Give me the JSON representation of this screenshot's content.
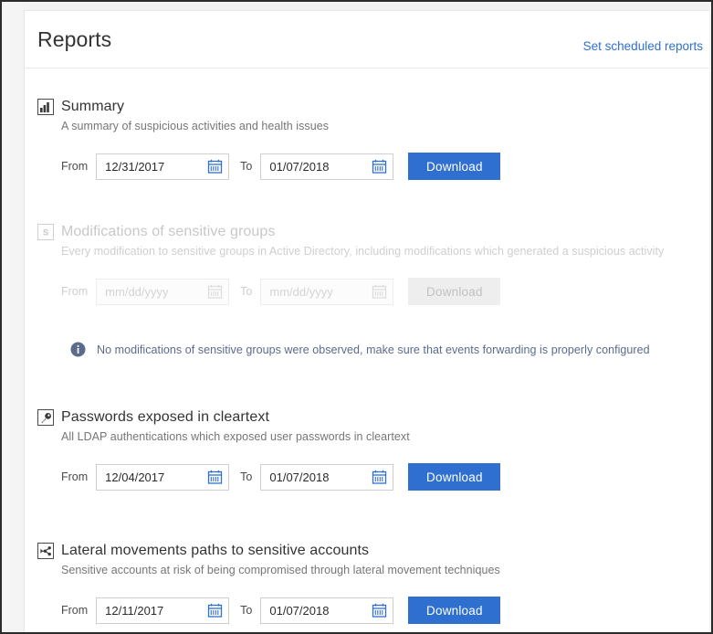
{
  "header": {
    "title": "Reports",
    "scheduled_link": "Set scheduled reports"
  },
  "colors": {
    "accent": "#2f6fd0",
    "title": "#333333",
    "description": "#767676",
    "disabled_text": "#c8c8c8",
    "info_text": "#5b6b8c",
    "border": "#cfcfcf"
  },
  "labels": {
    "from": "From",
    "to": "To",
    "download": "Download",
    "date_placeholder": "mm/dd/yyyy"
  },
  "reports": [
    {
      "icon": "bar-chart-icon",
      "title": "Summary",
      "description": "A summary of suspicious activities and health issues",
      "from_label": "From",
      "from_value": "12/31/2017",
      "to_label": "To",
      "to_value": "01/07/2018",
      "download_label": "Download",
      "enabled": true
    },
    {
      "icon": "sensitive-group-icon",
      "title": "Modifications of sensitive groups",
      "description": "Every modification to sensitive groups in Active Directory, including modifications which generated a suspicious activity",
      "from_label": "From",
      "from_value": "mm/dd/yyyy",
      "to_label": "To",
      "to_value": "mm/dd/yyyy",
      "download_label": "Download",
      "enabled": false,
      "info_message": "No modifications of sensitive groups were observed, make sure that events forwarding is properly configured"
    },
    {
      "icon": "key-icon",
      "title": "Passwords exposed in cleartext",
      "description": "All LDAP authentications which exposed user passwords in cleartext",
      "from_label": "From",
      "from_value": "12/04/2017",
      "to_label": "To",
      "to_value": "01/07/2018",
      "download_label": "Download",
      "enabled": true
    },
    {
      "icon": "lateral-movement-icon",
      "title": "Lateral movements paths to sensitive accounts",
      "description": "Sensitive accounts at risk of being compromised through lateral movement techniques",
      "from_label": "From",
      "from_value": "12/11/2017",
      "to_label": "To",
      "to_value": "01/07/2018",
      "download_label": "Download",
      "enabled": true
    }
  ]
}
